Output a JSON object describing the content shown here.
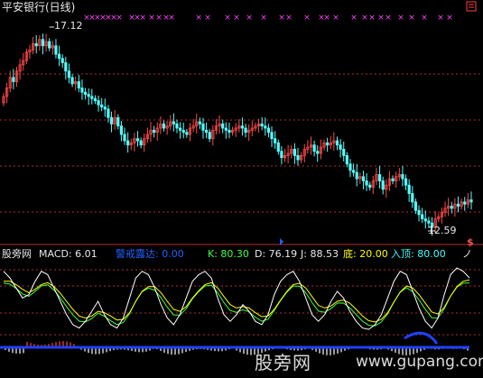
{
  "header": {
    "title": "平安银行(日线)",
    "high_label": "17.12",
    "low_label": "12.59",
    "dollar_sign": "$"
  },
  "indicator": {
    "site_label": "股旁网",
    "macd_label": "MACD: 6.01",
    "alert_label": "警戒露达: 0.00",
    "k_label": "K: 80.30",
    "d_label": "D: 76.19",
    "j_label": "J: 88.53",
    "bottom_label": "底: 20.00",
    "top_label": "入顶: 80.00",
    "more_mark": "ノ"
  },
  "watermark": {
    "text": "股旁网",
    "url": "www.gupang.com"
  },
  "colors": {
    "background": "#000000",
    "up_candle": "#ff4848",
    "down_candle": "#54ffff",
    "grid": "#b03030",
    "x_marks": "#ff40ff",
    "k_line": "#ffffff",
    "d_line": "#ffff00",
    "j_line": "#40ff40",
    "zero_line": "#2040ff",
    "alert_label": "#2060ff",
    "kdj_label": "#40ff40",
    "bottom_label": "#ffff00",
    "macd_neg": "#ffffff",
    "macd_pos": "#ff4848"
  },
  "chart_data": [
    {
      "type": "candlestick",
      "title": "平安银行(日线)",
      "ylim": [
        12.3,
        17.6
      ],
      "annotations": [
        {
          "text": "17.12",
          "at_index": 14
        },
        {
          "text": "12.59",
          "at_index": 132
        }
      ],
      "open": [
        15.55,
        15.7,
        15.9,
        16.15,
        16.05,
        16.3,
        16.45,
        16.55,
        16.75,
        16.8,
        16.95,
        16.9,
        17.05,
        16.9,
        17.0,
        16.85,
        16.9,
        16.7,
        16.6,
        16.5,
        16.3,
        16.15,
        16.0,
        16.05,
        15.9,
        15.8,
        15.75,
        15.7,
        15.65,
        15.6,
        15.5,
        15.45,
        15.4,
        15.2,
        15.05,
        15.2,
        15.0,
        14.8,
        14.65,
        14.55,
        14.6,
        14.7,
        14.65,
        14.55,
        14.7,
        14.8,
        14.9,
        14.85,
        14.95,
        15.05,
        14.95,
        15.0,
        15.1,
        15.05,
        14.95,
        14.9,
        14.85,
        14.8,
        14.95,
        15.0,
        15.1,
        15.05,
        14.9,
        14.85,
        14.7,
        14.9,
        15.0,
        15.05,
        14.95,
        14.9,
        14.85,
        14.9,
        14.95,
        15.0,
        14.95,
        14.85,
        14.9,
        14.95,
        15.0,
        15.05,
        15.0,
        14.95,
        14.85,
        14.7,
        14.6,
        14.4,
        14.25,
        14.3,
        14.35,
        14.45,
        14.3,
        14.2,
        14.3,
        14.45,
        14.5,
        14.55,
        14.4,
        14.35,
        14.5,
        14.6,
        14.55,
        14.6,
        14.65,
        14.55,
        14.45,
        14.3,
        14.1,
        13.95,
        13.9,
        13.75,
        13.8,
        13.7,
        13.6,
        13.55,
        13.7,
        13.85,
        13.7,
        13.5,
        13.6,
        13.75,
        13.7,
        13.8,
        13.85,
        13.75,
        13.6,
        13.4,
        13.2,
        13.0,
        12.9,
        12.8,
        12.75,
        12.7,
        12.6,
        12.8,
        12.85,
        12.95,
        13.05,
        13.1,
        13.05,
        13.15,
        13.1,
        13.2,
        13.15,
        13.25
      ],
      "close": [
        15.7,
        15.9,
        16.15,
        16.05,
        16.3,
        16.45,
        16.55,
        16.75,
        16.8,
        16.95,
        16.9,
        17.05,
        16.9,
        17.0,
        16.85,
        16.9,
        16.7,
        16.6,
        16.5,
        16.3,
        16.15,
        16.0,
        16.05,
        15.9,
        15.8,
        15.75,
        15.7,
        15.65,
        15.6,
        15.5,
        15.45,
        15.4,
        15.2,
        15.05,
        15.2,
        15.0,
        14.8,
        14.65,
        14.55,
        14.6,
        14.7,
        14.65,
        14.55,
        14.7,
        14.8,
        14.9,
        14.85,
        14.95,
        15.05,
        14.95,
        15.0,
        15.1,
        15.05,
        14.95,
        14.9,
        14.85,
        14.8,
        14.95,
        15.0,
        15.1,
        15.05,
        14.9,
        14.85,
        14.7,
        14.9,
        15.0,
        15.05,
        14.95,
        14.9,
        14.85,
        14.9,
        14.95,
        15.0,
        14.95,
        14.85,
        14.9,
        14.95,
        15.0,
        15.05,
        15.0,
        14.95,
        14.85,
        14.7,
        14.6,
        14.4,
        14.25,
        14.3,
        14.35,
        14.45,
        14.3,
        14.2,
        14.3,
        14.45,
        14.5,
        14.55,
        14.4,
        14.35,
        14.5,
        14.6,
        14.55,
        14.6,
        14.65,
        14.55,
        14.45,
        14.3,
        14.1,
        13.95,
        13.9,
        13.75,
        13.8,
        13.7,
        13.6,
        13.55,
        13.7,
        13.85,
        13.7,
        13.5,
        13.6,
        13.75,
        13.7,
        13.8,
        13.85,
        13.75,
        13.6,
        13.4,
        13.2,
        13.0,
        12.9,
        12.8,
        12.75,
        12.7,
        12.6,
        12.8,
        12.85,
        12.95,
        13.05,
        13.1,
        13.05,
        13.15,
        13.1,
        13.2,
        13.15,
        13.25,
        13.2
      ],
      "high_index": 14,
      "low_index": 132
    },
    {
      "type": "line",
      "title": "MACD / KDJ",
      "series": [
        {
          "name": "K",
          "color": "#ffffff"
        },
        {
          "name": "D",
          "color": "#ffff00"
        },
        {
          "name": "J",
          "color": "#40ff40"
        }
      ],
      "k_values": [
        0.95,
        0.85,
        0.7,
        0.55,
        0.6,
        0.8,
        0.95,
        0.9,
        0.7,
        0.5,
        0.3,
        0.15,
        0.1,
        0.2,
        0.35,
        0.5,
        0.3,
        0.15,
        0.1,
        0.25,
        0.55,
        0.85,
        0.95,
        0.9,
        0.7,
        0.45,
        0.25,
        0.15,
        0.3,
        0.55,
        0.8,
        0.9,
        0.95,
        0.85,
        0.55,
        0.3,
        0.2,
        0.3,
        0.45,
        0.35,
        0.2,
        0.15,
        0.3,
        0.6,
        0.8,
        0.9,
        0.95,
        0.8,
        0.55,
        0.3,
        0.2,
        0.3,
        0.5,
        0.65,
        0.55,
        0.35,
        0.2,
        0.1,
        0.08,
        0.15,
        0.3,
        0.55,
        0.8,
        0.95,
        0.9,
        0.65,
        0.4,
        0.2,
        0.1,
        0.25,
        0.6,
        0.9,
        1.0,
        0.95,
        0.85
      ],
      "d_values": [
        0.8,
        0.8,
        0.75,
        0.68,
        0.63,
        0.68,
        0.75,
        0.78,
        0.72,
        0.62,
        0.5,
        0.38,
        0.28,
        0.25,
        0.28,
        0.35,
        0.33,
        0.28,
        0.22,
        0.23,
        0.33,
        0.5,
        0.65,
        0.72,
        0.72,
        0.63,
        0.5,
        0.38,
        0.35,
        0.42,
        0.55,
        0.66,
        0.75,
        0.78,
        0.7,
        0.57,
        0.45,
        0.4,
        0.42,
        0.4,
        0.33,
        0.27,
        0.28,
        0.38,
        0.52,
        0.65,
        0.75,
        0.77,
        0.7,
        0.57,
        0.44,
        0.4,
        0.43,
        0.5,
        0.52,
        0.47,
        0.38,
        0.28,
        0.21,
        0.19,
        0.23,
        0.33,
        0.49,
        0.64,
        0.73,
        0.7,
        0.6,
        0.47,
        0.34,
        0.31,
        0.41,
        0.58,
        0.72,
        0.8,
        0.82
      ],
      "zero_level": 0.0
    }
  ]
}
